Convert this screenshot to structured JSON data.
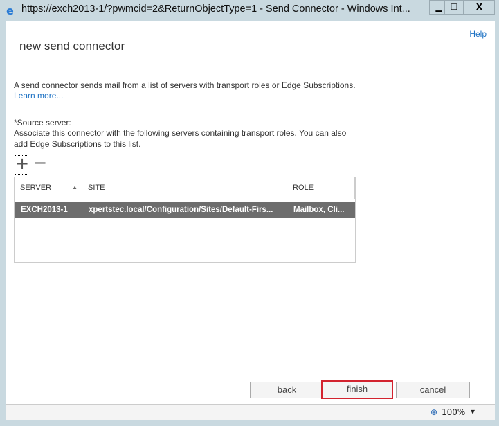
{
  "window": {
    "title": "https://exch2013-1/?pwmcid=2&ReturnObjectType=1 - Send Connector - Windows Int...",
    "minimize": "▁",
    "maximize": "☐",
    "close": "X"
  },
  "help": "Help",
  "heading": "new send connector",
  "intro": "A send connector sends mail from a list of servers with transport roles or Edge Subscriptions.",
  "learn_more": "Learn more...",
  "source_label": "*Source server:",
  "source_desc_1": "Associate this connector with the following servers containing transport roles. You can also",
  "source_desc_2": "add Edge Subscriptions to this list.",
  "toolbar": {
    "add": "+",
    "remove": "−"
  },
  "grid": {
    "columns": [
      "SERVER",
      "SITE",
      "ROLE"
    ],
    "sort_indicator": "▲",
    "rows": [
      {
        "server": "EXCH2013-1",
        "site": "xpertstec.local/Configuration/Sites/Default-Firs...",
        "role": "Mailbox, Cli..."
      }
    ]
  },
  "buttons": {
    "back": "back",
    "finish": "finish",
    "cancel": "cancel"
  },
  "status": {
    "zoom": "100%",
    "zoom_arrow": "▾"
  },
  "colors": {
    "highlight": "#d3232f",
    "selected_row": "#6d6d6d",
    "link": "#1e72c4"
  }
}
